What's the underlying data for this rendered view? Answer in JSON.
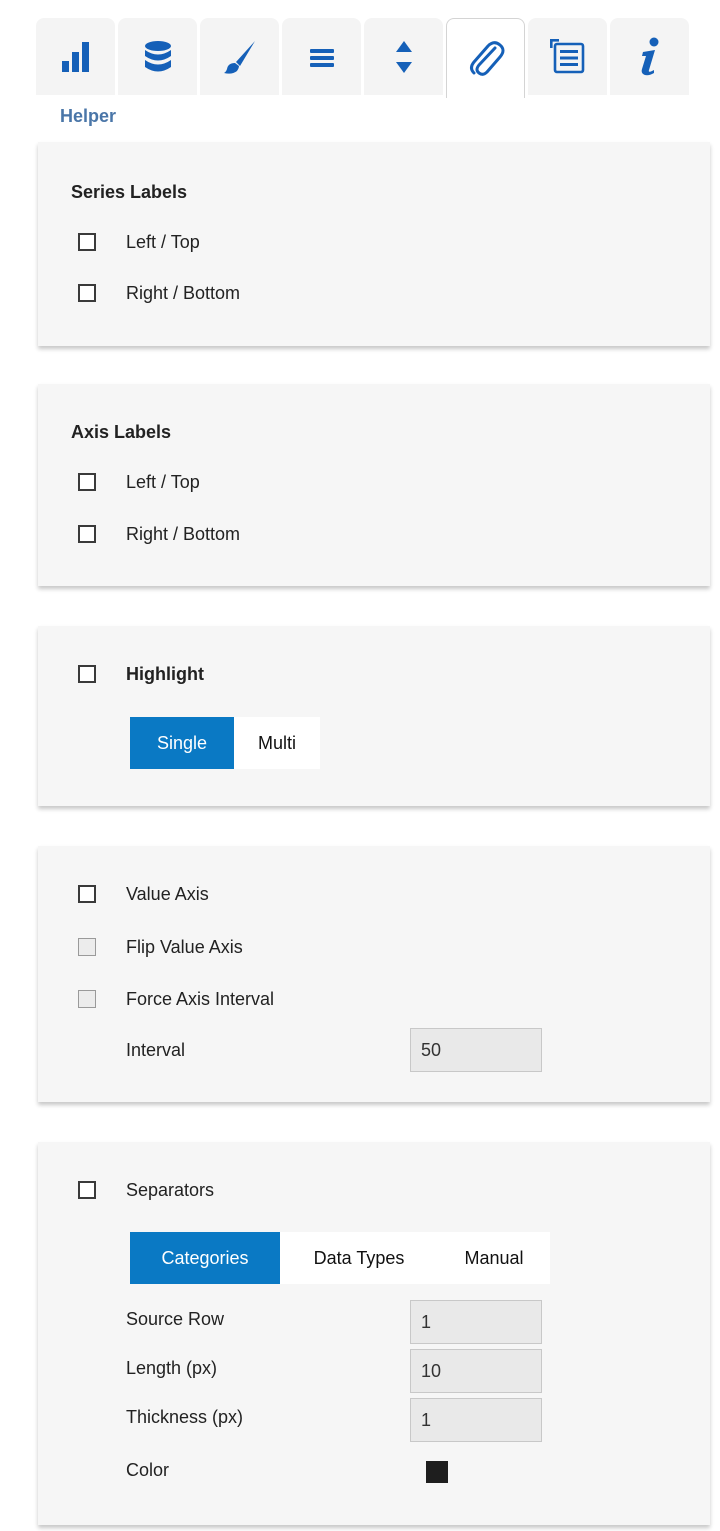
{
  "tabs": [
    {
      "icon": "bar-chart-icon"
    },
    {
      "icon": "database-icon"
    },
    {
      "icon": "brush-icon"
    },
    {
      "icon": "list-icon"
    },
    {
      "icon": "sort-icon"
    },
    {
      "icon": "paperclip-icon",
      "active": true
    },
    {
      "icon": "numbered-list-icon"
    },
    {
      "icon": "info-icon"
    }
  ],
  "section_title": "Helper",
  "series_labels": {
    "heading": "Series Labels",
    "left_top": {
      "label": "Left / Top",
      "checked": false
    },
    "right_bottom": {
      "label": "Right / Bottom",
      "checked": false
    }
  },
  "axis_labels": {
    "heading": "Axis Labels",
    "left_top": {
      "label": "Left / Top",
      "checked": false
    },
    "right_bottom": {
      "label": "Right / Bottom",
      "checked": false
    }
  },
  "highlight": {
    "label": "Highlight",
    "checked": false,
    "modes": [
      "Single",
      "Multi"
    ],
    "selected": "Single"
  },
  "value_axis": {
    "value_axis": {
      "label": "Value Axis",
      "checked": false
    },
    "flip": {
      "label": "Flip Value Axis",
      "checked": false,
      "disabled": true
    },
    "force_interval": {
      "label": "Force Axis Interval",
      "checked": false,
      "disabled": true
    },
    "interval_label": "Interval",
    "interval_value": "50"
  },
  "separators": {
    "label": "Separators",
    "checked": false,
    "modes": [
      "Categories",
      "Data Types",
      "Manual"
    ],
    "selected": "Categories",
    "source_row_label": "Source Row",
    "source_row_value": "1",
    "length_label": "Length (px)",
    "length_value": "10",
    "thickness_label": "Thickness (px)",
    "thickness_value": "1",
    "color_label": "Color",
    "color_value": "#1e1e1e"
  },
  "colors": {
    "accent": "#0a79c4",
    "icon_blue": "#1560b8",
    "title_blue": "#4a76a8"
  }
}
